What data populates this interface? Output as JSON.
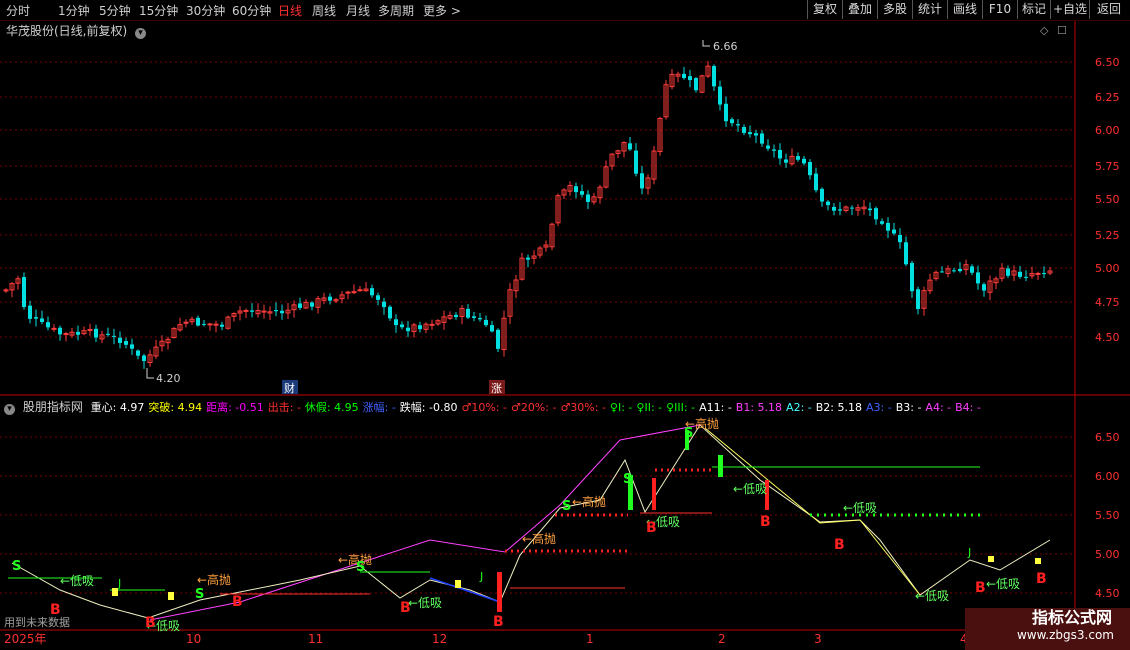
{
  "toolbar": {
    "periods": [
      "分时",
      "1分钟",
      "5分钟",
      "15分钟",
      "30分钟",
      "60分钟",
      "日线",
      "周线",
      "月线",
      "多周期",
      "更多 >"
    ],
    "active_period": "日线",
    "right_buttons": [
      "复权",
      "叠加",
      "多股",
      "统计",
      "画线",
      "F10",
      "标记",
      "+自选",
      "返回"
    ]
  },
  "stock_title": "华茂股份(日线,前复权)",
  "price_axis": [
    "6.50",
    "6.25",
    "6.00",
    "5.75",
    "5.50",
    "5.25",
    "5.00",
    "4.75",
    "4.50"
  ],
  "indicator_axis": [
    "6.50",
    "6.00",
    "5.50",
    "5.00",
    "4.50"
  ],
  "high_label": "6.66",
  "low_label": "4.20",
  "event_markers": {
    "cai": "财",
    "zhang": "涨"
  },
  "indicator_header": {
    "name": "股朋指标网",
    "items": [
      {
        "text": "重心: 4.97",
        "color": "#ffffff"
      },
      {
        "text": "突破: 4.94",
        "color": "#ffff00"
      },
      {
        "text": "距离: -0.51",
        "color": "#ff00ff"
      },
      {
        "text": "出击: -",
        "color": "#ff3030"
      },
      {
        "text": "休假: 4.95",
        "color": "#00ff00"
      },
      {
        "text": "涨幅: -",
        "color": "#4060ff"
      },
      {
        "text": "跌幅: -0.80",
        "color": "#ffffff"
      },
      {
        "text": "♂10%: -",
        "color": "#ff3030"
      },
      {
        "text": "♂20%: -",
        "color": "#ff3030"
      },
      {
        "text": "♂30%: -",
        "color": "#ff3030"
      },
      {
        "text": "♀I: -",
        "color": "#00ff00"
      },
      {
        "text": "♀II: -",
        "color": "#00ff00"
      },
      {
        "text": "♀III: -",
        "color": "#00ff00"
      },
      {
        "text": "A11: -",
        "color": "#ffffff"
      },
      {
        "text": "B1: 5.18",
        "color": "#ff40ff"
      },
      {
        "text": "A2: -",
        "color": "#40ffff"
      },
      {
        "text": "B2: 5.18",
        "color": "#ffffff"
      },
      {
        "text": "A3: -",
        "color": "#4060ff"
      },
      {
        "text": "B3: -",
        "color": "#ffffff"
      },
      {
        "text": "A4: -",
        "color": "#ff40ff"
      },
      {
        "text": "B4: -",
        "color": "#ff40ff"
      }
    ]
  },
  "labels": {
    "high_throw": "←高抛",
    "low_buy": "←低吸",
    "b": "B",
    "s": "S",
    "j": "J",
    "future_data": "用到未来数据"
  },
  "date_axis": [
    "2025年",
    "10",
    "11",
    "12",
    "1",
    "2",
    "3",
    "4"
  ],
  "watermark": {
    "line1": "指标公式网",
    "line2": "www.zbgs3.com"
  },
  "colors": {
    "up": "#ff3c3c",
    "down": "#00e0e0",
    "grid": "#7a0000",
    "axis": "#c00000"
  }
}
